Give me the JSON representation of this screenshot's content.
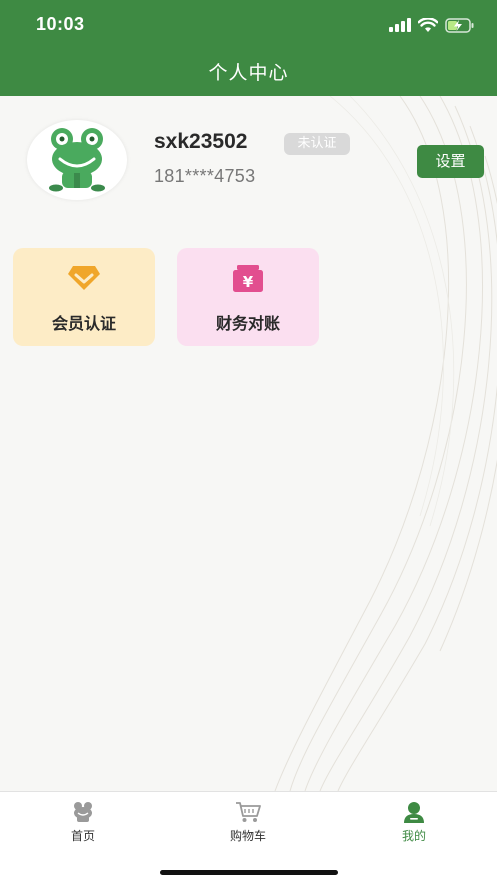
{
  "status_bar": {
    "time": "10:03"
  },
  "header": {
    "title": "个人中心"
  },
  "profile": {
    "username": "sxk23502",
    "verification_badge": "未认证",
    "phone": "181****4753",
    "settings_label": "设置"
  },
  "cards": [
    {
      "label": "会员认证",
      "icon": "diamond-icon",
      "color": "#fdecc6"
    },
    {
      "label": "财务对账",
      "icon": "yuan-wallet-icon",
      "color": "#fbdff0"
    }
  ],
  "tabbar": {
    "items": [
      {
        "label": "首页",
        "icon": "frog-home-icon"
      },
      {
        "label": "购物车",
        "icon": "cart-icon"
      },
      {
        "label": "我的",
        "icon": "user-icon",
        "active": true
      }
    ]
  },
  "colors": {
    "brand": "#3e8a43",
    "badge_bg": "#d9d9d9"
  }
}
